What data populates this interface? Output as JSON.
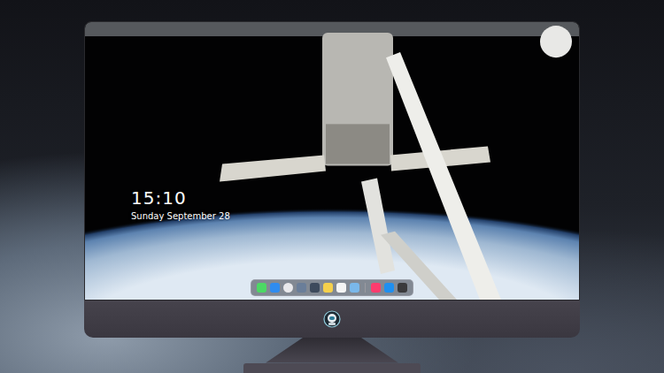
{
  "lock_screen": {
    "time": "15:10",
    "date": "Sunday September 28"
  },
  "dock": {
    "apps": [
      {
        "kind": "square",
        "color": "#4cd964"
      },
      {
        "kind": "square",
        "color": "#2f8cf0"
      },
      {
        "kind": "circle",
        "color": "#e9e9ec"
      },
      {
        "kind": "square",
        "color": "#6a7e99"
      },
      {
        "kind": "square",
        "color": "#3d4a5c"
      },
      {
        "kind": "square",
        "color": "#f5d04c"
      },
      {
        "kind": "square",
        "color": "#f4f4f4"
      },
      {
        "kind": "square",
        "color": "#7ab8ea"
      },
      {
        "kind": "separator",
        "color": "#9a9aa0"
      },
      {
        "kind": "square",
        "color": "#fc3c6e"
      },
      {
        "kind": "square",
        "color": "#1e8ff0"
      },
      {
        "kind": "square",
        "color": "#3a3a3c"
      }
    ]
  }
}
